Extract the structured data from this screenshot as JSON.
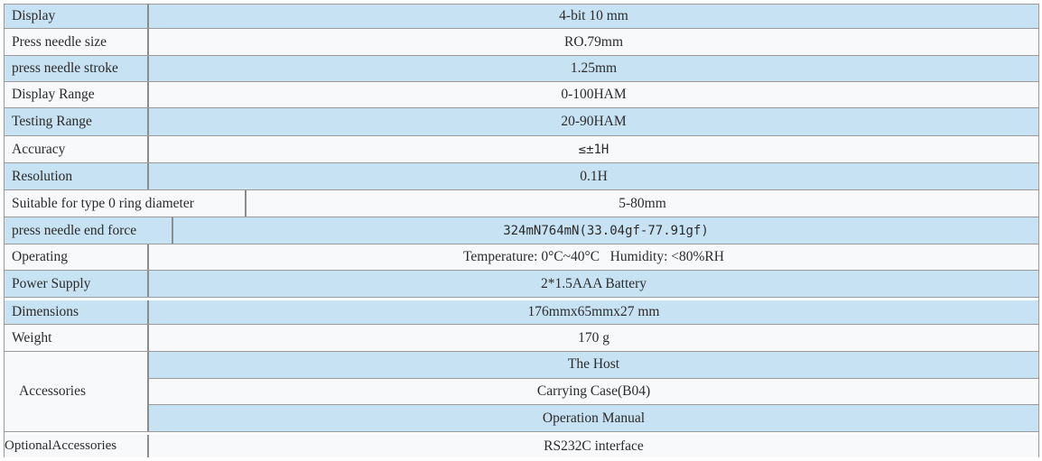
{
  "rows": [
    {
      "label": "Display",
      "value": "4-bit 10 mm"
    },
    {
      "label": "Press needle size",
      "value": "RO.79mm"
    },
    {
      "label": "press needle stroke",
      "value": "1.25mm"
    },
    {
      "label": "Display Range",
      "value": "0-100HAM"
    },
    {
      "label": "Testing Range",
      "value": "20-90HAM"
    },
    {
      "label": "Accuracy",
      "value": "≤±1H"
    },
    {
      "label": "Resolution",
      "value": "0.1H"
    },
    {
      "label": "Suitable for type 0 ring diameter",
      "value": "5-80mm"
    },
    {
      "label": "press needle end force",
      "value": "324mN764mN(33.04gf-77.91gf)"
    },
    {
      "label": "Operating",
      "value": "Temperature: 0°C~40°C   Humidity: <80%RH"
    },
    {
      "label": "Power Supply",
      "value": "2*1.5AAA Battery"
    },
    {
      "label": "Dimensions",
      "value": "176mmx65mmx27 mm"
    },
    {
      "label": "Weight",
      "value": "170 g"
    }
  ],
  "accessories": {
    "label": "Accessories",
    "items": [
      "The Host",
      "Carrying Case(B04)",
      "Operation Manual"
    ]
  },
  "optional": {
    "label": "OptionalAccessories",
    "value": "RS232C interface"
  }
}
